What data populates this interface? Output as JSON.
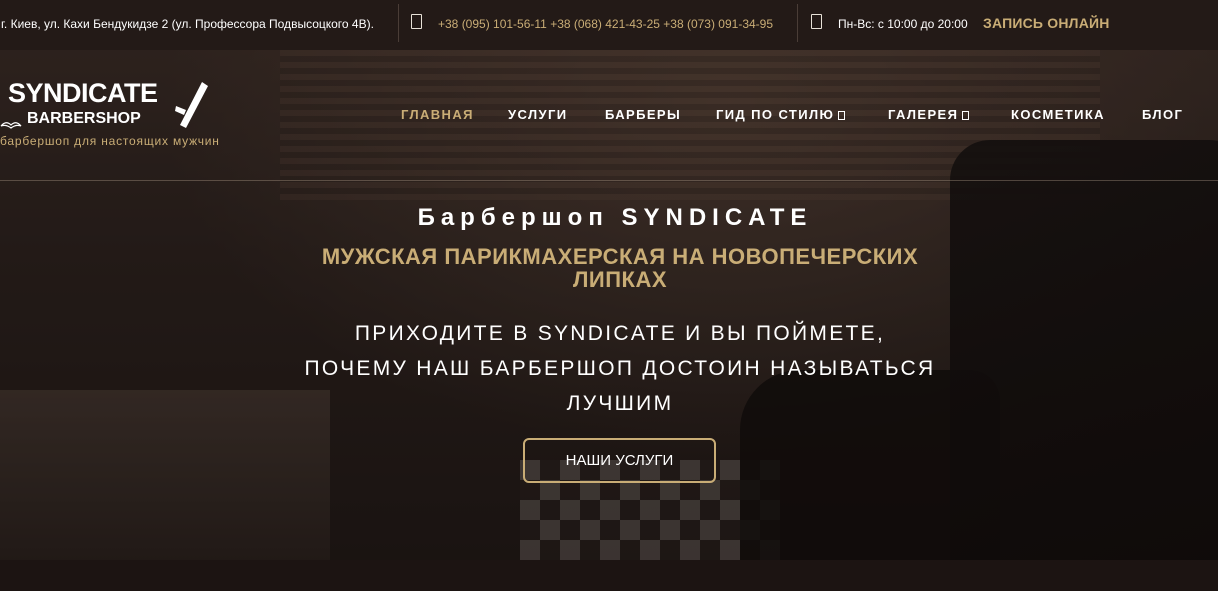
{
  "topbar": {
    "address": "г. Киев, ул. Кахи Бендукидзе 2 (ул. Профессора Подвысоцкого 4В).",
    "phones": "+38 (095) 101-56-11 +38 (068) 421-43-25 +38 (073) 091-34-95",
    "hours": "Пн-Вс: с 10:00 до 20:00",
    "booking": "ЗАПИСЬ ОНЛАЙН"
  },
  "logo": {
    "name": "SYNDICATE",
    "sub": "BARBERSHOP",
    "tagline": "барбершоп для настоящих мужчин"
  },
  "nav": {
    "items": [
      {
        "label": "ГЛАВНАЯ",
        "active": true
      },
      {
        "label": "УСЛУГИ"
      },
      {
        "label": "БАРБЕРЫ"
      },
      {
        "label": "ГИД ПО СТИЛЮ"
      },
      {
        "label": "ГАЛЕРЕЯ"
      },
      {
        "label": "КОСМЕТИКА"
      },
      {
        "label": "БЛОГ"
      }
    ]
  },
  "hero": {
    "title": "Барбершоп SYNDICATE",
    "subtitle": "МУЖСКАЯ ПАРИКМАХЕРСКАЯ НА НОВОПЕЧЕРСКИХ ЛИПКАХ",
    "text": "ПРИХОДИТЕ В SYNDICATE И ВЫ ПОЙМЕТЕ, ПОЧЕМУ НАШ БАРБЕРШОП ДОСТОИН НАЗЫВАТЬСЯ ЛУЧШИМ",
    "cta": "НАШИ УСЛУГИ"
  },
  "colors": {
    "accent": "#c9ad76",
    "topbar_bg": "#231a17",
    "page_bg": "#1c1412"
  },
  "icons": {
    "phone": "phone-icon",
    "clock": "clock-icon",
    "razor": "razor-icon",
    "mustache": "mustache-icon",
    "dropdown": "chevron-down-icon"
  }
}
